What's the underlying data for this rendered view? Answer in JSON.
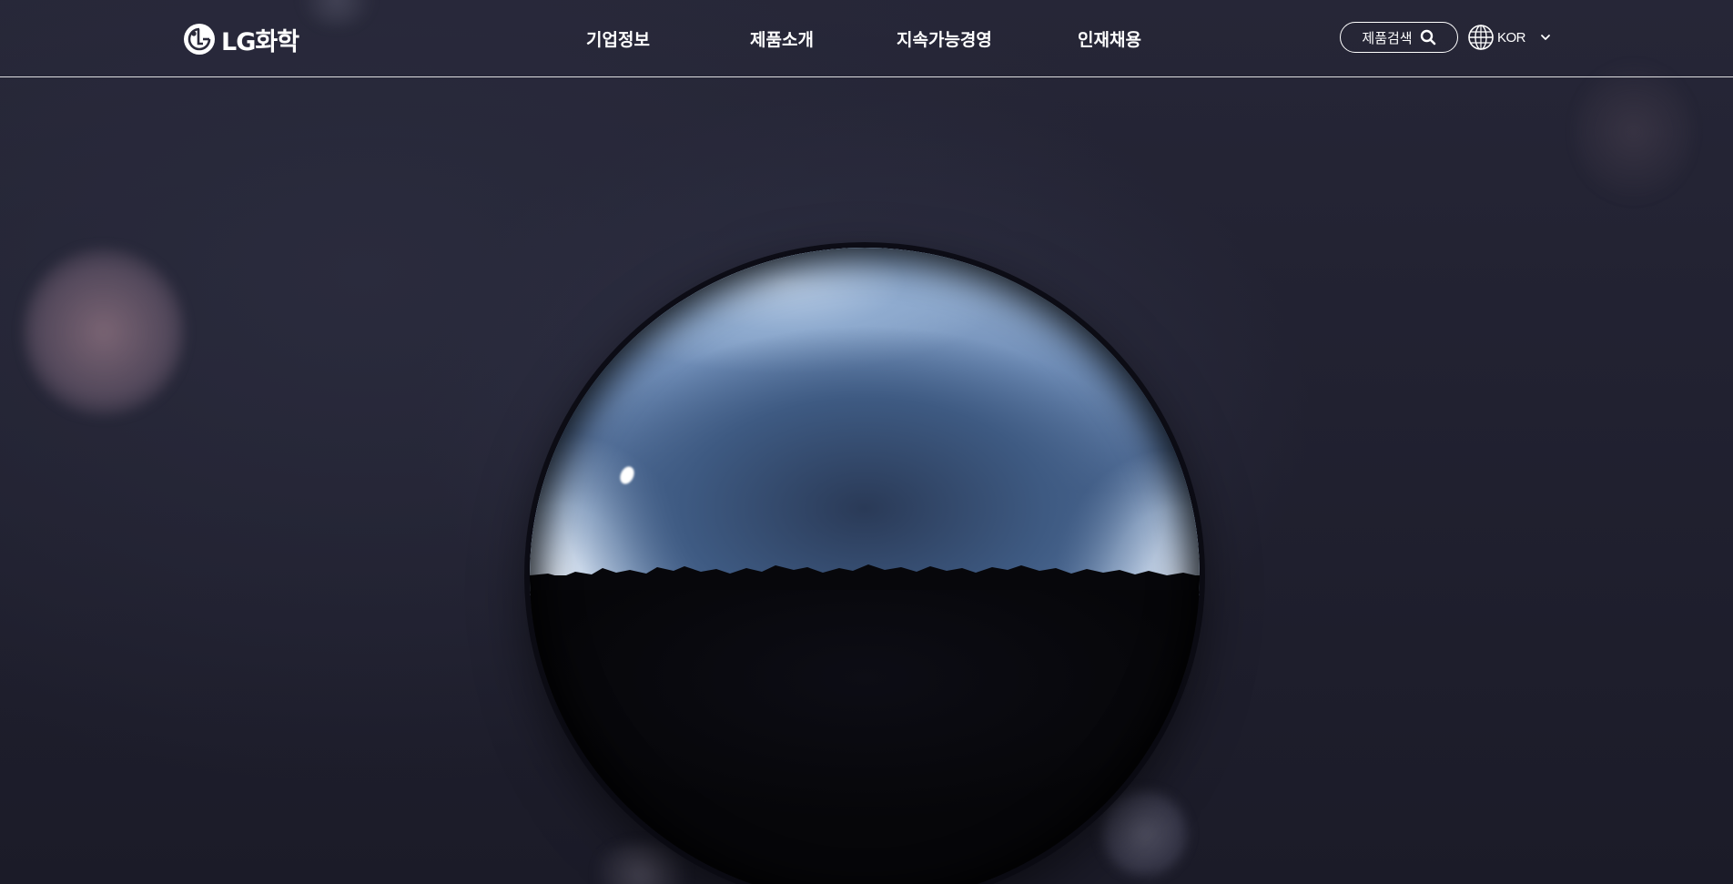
{
  "header": {
    "logo": {
      "brand": "LG",
      "name": "화학"
    },
    "nav": [
      {
        "label": "기업정보"
      },
      {
        "label": "제품소개"
      },
      {
        "label": "지속가능경영"
      },
      {
        "label": "인재채용"
      }
    ],
    "search": {
      "label": "제품검색",
      "icon": "search-icon"
    },
    "language": {
      "icon": "globe-icon",
      "selected": "KOR",
      "dropdown_icon": "chevron-down-icon"
    }
  },
  "hero": {
    "media": "water-droplet-sphere"
  },
  "colors": {
    "header_text": "#ffffff",
    "background": "#1c1c2b"
  }
}
